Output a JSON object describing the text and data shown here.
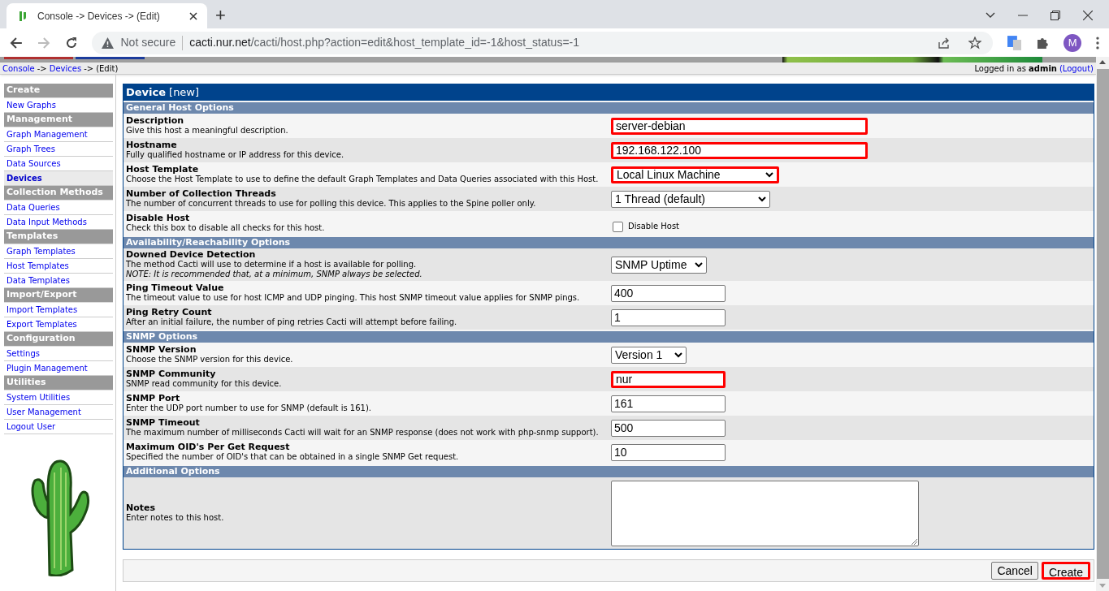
{
  "browser": {
    "tab_title": "Console -> Devices -> (Edit)",
    "new_tab": "+",
    "security": "Not secure",
    "url_host": "cacti.nur.net",
    "url_path": "/cacti/host.php?action=edit&host_template_id=-1&host_status=-1",
    "avatar": "M"
  },
  "breadcrumb": [
    {
      "kind": "link",
      "text": "Console"
    },
    {
      "kind": "separator",
      "text": "->"
    },
    {
      "kind": "link",
      "text": "Devices"
    },
    {
      "kind": "separator",
      "text": "->"
    },
    {
      "kind": "current",
      "text": "(Edit)"
    }
  ],
  "login": {
    "text": "Logged in as **admin**",
    "logout": "(Logout)"
  },
  "sidebar": [
    {
      "kind": "header",
      "label": "Create"
    },
    {
      "kind": "link",
      "label": "New Graphs",
      "selected": false
    },
    {
      "kind": "header",
      "label": "Management"
    },
    {
      "kind": "link",
      "label": "Graph Management",
      "selected": false
    },
    {
      "kind": "link",
      "label": "Graph Trees",
      "selected": false
    },
    {
      "kind": "link",
      "label": "Data Sources",
      "selected": false
    },
    {
      "kind": "link",
      "label": "Devices",
      "selected": true
    },
    {
      "kind": "header",
      "label": "Collection Methods"
    },
    {
      "kind": "link",
      "label": "Data Queries",
      "selected": false
    },
    {
      "kind": "link",
      "label": "Data Input Methods",
      "selected": false
    },
    {
      "kind": "header",
      "label": "Templates"
    },
    {
      "kind": "link",
      "label": "Graph Templates",
      "selected": false
    },
    {
      "kind": "link",
      "label": "Host Templates",
      "selected": false
    },
    {
      "kind": "link",
      "label": "Data Templates",
      "selected": false
    },
    {
      "kind": "header",
      "label": "Import/Export"
    },
    {
      "kind": "link",
      "label": "Import Templates",
      "selected": false
    },
    {
      "kind": "link",
      "label": "Export Templates",
      "selected": false
    },
    {
      "kind": "header",
      "label": "Configuration"
    },
    {
      "kind": "link",
      "label": "Settings",
      "selected": false
    },
    {
      "kind": "link",
      "label": "Plugin Management",
      "selected": false
    },
    {
      "kind": "header",
      "label": "Utilities"
    },
    {
      "kind": "link",
      "label": "System Utilities",
      "selected": false
    },
    {
      "kind": "link",
      "label": "User Management",
      "selected": false
    },
    {
      "kind": "link",
      "label": "Logout User",
      "selected": false
    }
  ],
  "form": {
    "title": "Device",
    "title_suffix": "[new]",
    "sections": [
      {
        "heading": "General Host Options",
        "rows": [
          {
            "label": "Description",
            "description": "Give this host a meaningful description.",
            "control": {
              "kind": "text",
              "value": "server-debian",
              "highlighted": true
            }
          },
          {
            "label": "Hostname",
            "description": "Fully qualified hostname or IP address for this device.",
            "control": {
              "kind": "text",
              "value": "192.168.122.100",
              "highlighted": true
            }
          },
          {
            "label": "Host Template",
            "description": "Choose the Host Template to use to define the default Graph Templates and Data Queries associated with this Host.",
            "control": {
              "kind": "select",
              "value": "Local Linux Machine",
              "highlighted": true
            }
          },
          {
            "label": "Number of Collection Threads",
            "description": "The number of concurrent threads to use for polling this device. This applies to the Spine poller only.",
            "control": {
              "kind": "select",
              "value": "1 Thread (default)",
              "highlighted": false
            }
          },
          {
            "label": "Disable Host",
            "description": "Check this box to disable all checks for this host.",
            "control": {
              "kind": "checkbox",
              "value": "Disable Host",
              "checked": false,
              "highlighted": false
            }
          }
        ]
      },
      {
        "heading": "Availability/Reachability Options",
        "rows": [
          {
            "label": "Downed Device Detection",
            "description": "The method Cacti will use to determine if a host is available for polling.",
            "note": "NOTE: It is recommended that, at a minimum, SNMP always be selected.",
            "control": {
              "kind": "select",
              "value": "SNMP Uptime",
              "highlighted": false
            }
          },
          {
            "label": "Ping Timeout Value",
            "description": "The timeout value to use for host ICMP and UDP pinging. This host SNMP timeout value applies for SNMP pings.",
            "control": {
              "kind": "text",
              "value": "400",
              "highlighted": false
            }
          },
          {
            "label": "Ping Retry Count",
            "description": "After an initial failure, the number of ping retries Cacti will attempt before failing.",
            "control": {
              "kind": "text",
              "value": "1",
              "highlighted": false
            }
          }
        ]
      },
      {
        "heading": "SNMP Options",
        "rows": [
          {
            "label": "SNMP Version",
            "description": "Choose the SNMP version for this device.",
            "control": {
              "kind": "select",
              "value": "Version 1",
              "highlighted": false
            }
          },
          {
            "label": "SNMP Community",
            "description": "SNMP read community for this device.",
            "control": {
              "kind": "text",
              "value": "nur",
              "highlighted": true
            }
          },
          {
            "label": "SNMP Port",
            "description": "Enter the UDP port number to use for SNMP (default is 161).",
            "control": {
              "kind": "text",
              "value": "161",
              "highlighted": false
            }
          },
          {
            "label": "SNMP Timeout",
            "description": "The maximum number of milliseconds Cacti will wait for an SNMP response (does not work with php-snmp support).",
            "control": {
              "kind": "text",
              "value": "500",
              "highlighted": false
            }
          },
          {
            "label": "Maximum OID's Per Get Request",
            "description": "Specified the number of OID's that can be obtained in a single SNMP Get request.",
            "control": {
              "kind": "text",
              "value": "10",
              "highlighted": false
            }
          }
        ]
      },
      {
        "heading": "Additional Options",
        "rows": [
          {
            "label": "Notes",
            "description": "Enter notes to this host.",
            "control": {
              "kind": "textarea",
              "highlighted": false
            }
          }
        ]
      }
    ]
  },
  "buttons": [
    {
      "label": "Cancel",
      "highlighted": false
    },
    {
      "label": "Create",
      "highlighted": true
    }
  ]
}
